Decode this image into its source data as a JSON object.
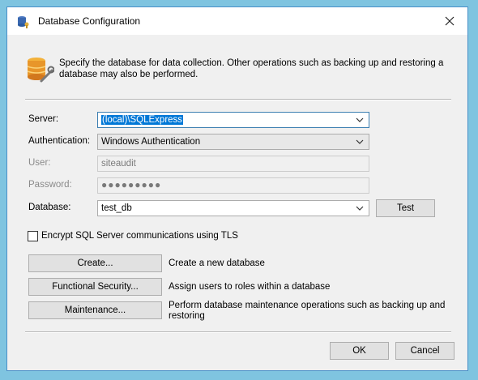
{
  "window": {
    "title": "Database Configuration"
  },
  "header": {
    "description": "Specify the database for data collection. Other operations such as backing up and restoring a database may also be performed."
  },
  "form": {
    "server": {
      "label": "Server:",
      "value": "(local)\\SQLExpress"
    },
    "authentication": {
      "label": "Authentication:",
      "value": "Windows Authentication"
    },
    "user": {
      "label": "User:",
      "value": "siteaudit"
    },
    "password": {
      "label": "Password:",
      "value": "●●●●●●●●●"
    },
    "database": {
      "label": "Database:",
      "value": "test_db"
    },
    "test_button": "Test",
    "encrypt": {
      "label": "Encrypt SQL Server communications using TLS",
      "checked": false
    }
  },
  "actions": [
    {
      "button": "Create...",
      "description": "Create a new database"
    },
    {
      "button": "Functional Security...",
      "description": "Assign users to roles within a database"
    },
    {
      "button": "Maintenance...",
      "description": "Perform database maintenance operations such as backing up and restoring"
    }
  ],
  "footer": {
    "ok": "OK",
    "cancel": "Cancel"
  },
  "icons": {
    "title": "database-key-icon",
    "header": "database-wrench-icon",
    "close": "close-icon",
    "dropdown": "chevron-down-icon"
  },
  "colors": {
    "selection": "#0078d7",
    "backdrop": "#7fc4e0"
  }
}
